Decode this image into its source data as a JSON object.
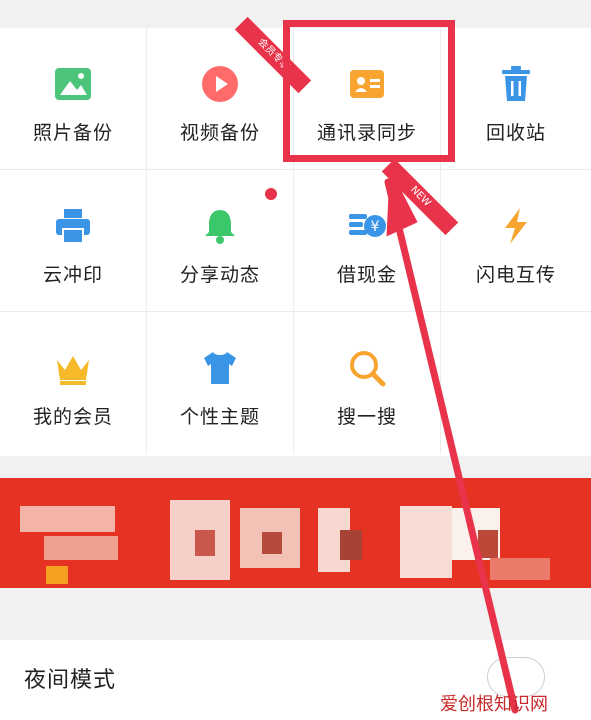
{
  "grid": {
    "items": [
      {
        "label": "照片备份",
        "icon": "photo-icon"
      },
      {
        "label": "视频备份",
        "icon": "video-play-icon"
      },
      {
        "label": "通讯录同步",
        "icon": "contact-card-icon"
      },
      {
        "label": "回收站",
        "icon": "trash-icon"
      },
      {
        "label": "云冲印",
        "icon": "printer-icon"
      },
      {
        "label": "分享动态",
        "icon": "bell-icon"
      },
      {
        "label": "借现金",
        "icon": "cash-icon"
      },
      {
        "label": "闪电互传",
        "icon": "lightning-icon"
      },
      {
        "label": "我的会员",
        "icon": "crown-icon"
      },
      {
        "label": "个性主题",
        "icon": "tshirt-icon"
      },
      {
        "label": "搜一搜",
        "icon": "search-icon"
      }
    ],
    "badges": {
      "member_ribbon": "会员专享",
      "new_ribbon": "NEW"
    }
  },
  "night_mode": {
    "label": "夜间模式",
    "enabled": false
  },
  "watermark": "爱创根知识网",
  "colors": {
    "highlight": "#e8334a",
    "banner": "#e63222",
    "photo": "#4cc47a",
    "video": "#ff6a6a",
    "contact": "#f7a530",
    "blue": "#3b95e6",
    "bell": "#3cc86a",
    "crown": "#f6b92a"
  }
}
